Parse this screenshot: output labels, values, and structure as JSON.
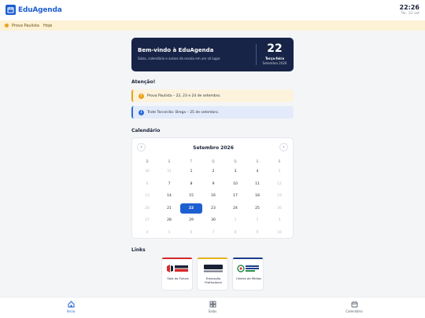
{
  "app": {
    "name": "EduAgenda"
  },
  "clock": {
    "time": "22:26",
    "date": "Ter, 22 set"
  },
  "notice_strip": {
    "text": "Prova Paulista",
    "when": "Hoje"
  },
  "hero": {
    "title": "Bem-vindo à EduAgenda",
    "subtitle": "Salas, calendário e avisos da escola em um só lugar.",
    "day": "22",
    "weekday": "Terça-feira",
    "month_year": "Setembro 2026"
  },
  "attention": {
    "title": "Atenção!",
    "alerts": [
      {
        "icon": "exclamation-icon",
        "text": "Prova Paulista – 22, 23 e 24 de setembro."
      },
      {
        "icon": "info-icon",
        "text": "Trote Terceirão: Brega – 25 de setembro."
      }
    ]
  },
  "calendar": {
    "title": "Calendário",
    "month_label": "Setembro 2026",
    "prev": "‹",
    "next": "›",
    "weekdays": [
      "D",
      "S",
      "T",
      "Q",
      "Q",
      "S",
      "S"
    ],
    "weeks": [
      [
        "30",
        "31",
        "1",
        "2",
        "3",
        "4",
        "5"
      ],
      [
        "6",
        "7",
        "8",
        "9",
        "10",
        "11",
        "12"
      ],
      [
        "13",
        "14",
        "15",
        "16",
        "17",
        "18",
        "19"
      ],
      [
        "20",
        "21",
        "22",
        "23",
        "24",
        "25",
        "26"
      ],
      [
        "27",
        "28",
        "29",
        "30",
        "1",
        "2",
        "3"
      ],
      [
        "4",
        "5",
        "6",
        "7",
        "8",
        "9",
        "10"
      ]
    ],
    "selected_day": "22"
  },
  "links": {
    "title": "Links",
    "items": [
      {
        "label": "Sala do Futuro",
        "accent": "#d62b2b"
      },
      {
        "label": "Educação Profissional",
        "accent": "#e8b417"
      },
      {
        "label": "Centro de Mídias",
        "accent": "#1d3f8a"
      }
    ]
  },
  "tabbar": {
    "items": [
      {
        "label": "Início",
        "icon": "home-icon",
        "active": true
      },
      {
        "label": "Salas",
        "icon": "grid-icon",
        "active": false
      },
      {
        "label": "Calendário",
        "icon": "calendar-icon",
        "active": false
      }
    ]
  },
  "colors": {
    "brand": "#1d5fd1",
    "hero_bg": "#172447",
    "warning": "#e8a317",
    "info": "#2d6bdb"
  }
}
